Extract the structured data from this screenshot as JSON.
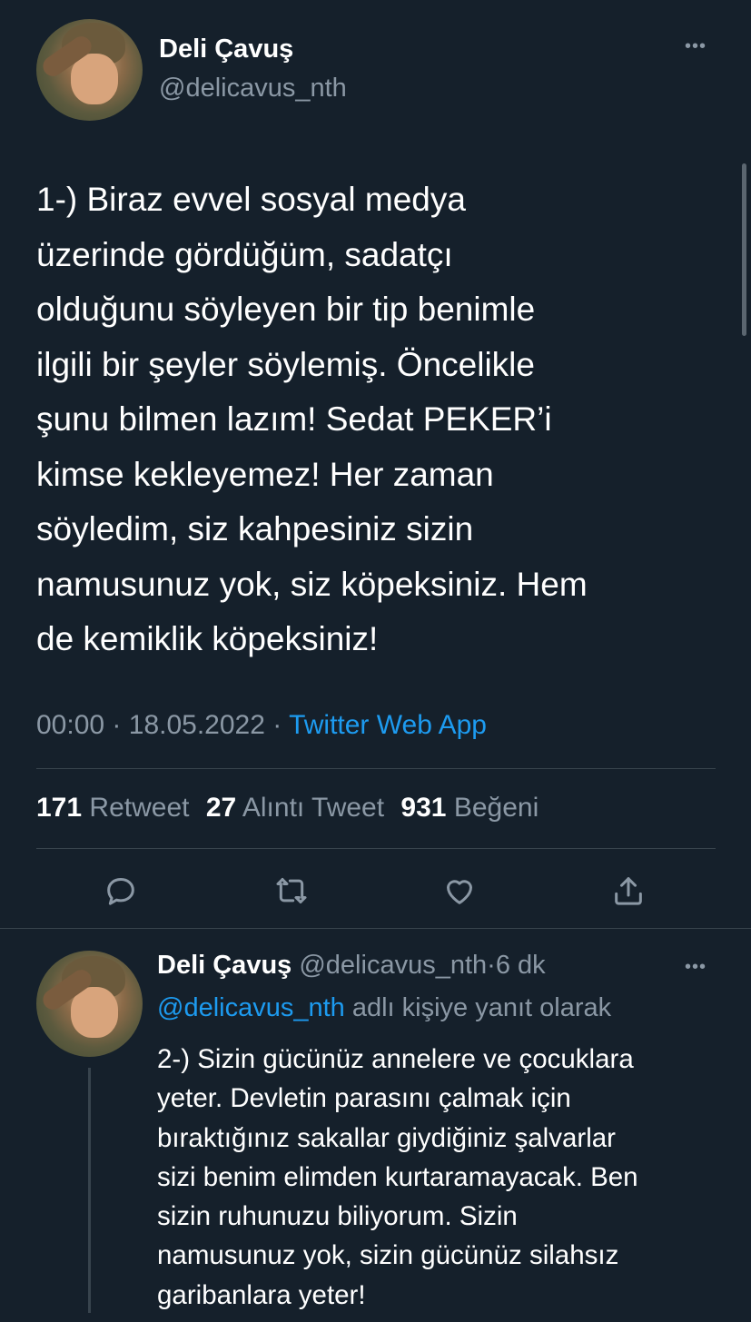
{
  "main_tweet": {
    "author_name": "Deli Çavuş",
    "author_handle": "@delicavus_nth",
    "text_lines": [
      "1-) Biraz evvel sosyal medya",
      "üzerinde gördüğüm, sadatçı",
      "olduğunu söyleyen bir tip benimle",
      "ilgili bir şeyler söylemiş. Öncelikle",
      "şunu bilmen lazım! Sedat PEKER’i",
      "kimse kekleyemez! Her zaman",
      "söyledim, siz kahpesiniz sizin",
      "namusunuz yok, siz köpeksiniz. Hem",
      "de kemiklik köpeksiniz!"
    ],
    "time": "00:00",
    "date": "18.05.2022",
    "separator": "·",
    "source": "Twitter Web App",
    "stats": {
      "retweets": "171",
      "retweets_label": "Retweet",
      "quotes": "27",
      "quotes_label": "Alıntı Tweet",
      "likes": "931",
      "likes_label": "Beğeni"
    },
    "more_glyph": "•••"
  },
  "reply_tweet": {
    "author_name": "Deli Çavuş",
    "author_handle": "@delicavus_nth",
    "separator": "·",
    "age": "6 dk",
    "replying_to_handle": "@delicavus_nth",
    "replying_to_suffix": "adlı kişiye yanıt olarak",
    "text_lines": [
      "2-) Sizin gücünüz annelere ve çocuklara",
      "yeter. Devletin parasını çalmak için",
      "bıraktığınız sakallar giydiğiniz şalvarlar",
      "sizi benim elimden kurtaramayacak. Ben",
      "sizin ruhunuzu biliyorum. Sizin",
      "namusunuz yok, sizin gücünüz silahsız",
      "garibanlara yeter!"
    ],
    "more_glyph": "•••"
  },
  "icons": {
    "reply": "reply-icon",
    "retweet": "retweet-icon",
    "like": "heart-icon",
    "share": "share-icon"
  },
  "colors": {
    "background": "#15202b",
    "text": "#ffffff",
    "muted": "#8b98a5",
    "link": "#1d9bf0",
    "divider": "#38444d"
  }
}
